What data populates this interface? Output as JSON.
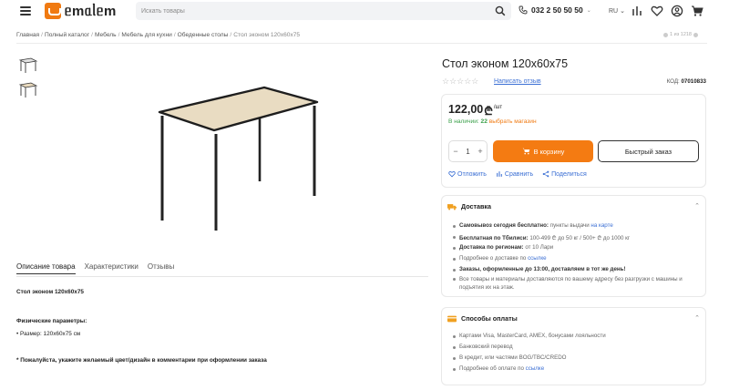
{
  "header": {
    "logo_text": "ᥱmᥲᥣᥱm",
    "search_placeholder": "Искать товары",
    "phone": "032 2 50 50 50",
    "phone_chevron": "⌄",
    "lang": "RU",
    "lang_chevron": "⌄",
    "brand_color": "#f07a12"
  },
  "breadcrumb": {
    "items": [
      "Главная",
      "Полный каталог",
      "Мебель",
      "Мебель для кухни",
      "Обеденные столы"
    ],
    "current": "Стол эконом 120х60х75",
    "separator": "/"
  },
  "counter": "1 из 1218",
  "tabs": [
    "Описание товара",
    "Характеристики",
    "Отзывы"
  ],
  "description": {
    "heading": "Стол эконом 120х60х75",
    "params_title": "Физические параметры:",
    "size": "• Размер: 120х60х75 см",
    "note": "* Пожалуйста, укажите желаемый цвет/дизайн в комментарии при оформлении заказа"
  },
  "product": {
    "title": "Стол эконом 120х60х75",
    "stars": "☆☆☆☆☆",
    "review_link": "Написать отзыв",
    "code_label": "КОД:",
    "code_value": "07010833",
    "price": "122,00",
    "currency": "₾",
    "price_unit": "/шт",
    "stock_label": "В наличии:",
    "stock_count": "22",
    "stock_link": "выбрать магазин",
    "qty_minus": "−",
    "qty_value": "1",
    "qty_plus": "+",
    "cart_label": "В корзину",
    "quick_label": "Быстрый заказ",
    "compare_links": [
      "Отложить",
      "Сравнить",
      "Поделиться"
    ]
  },
  "delivery": {
    "title": "Доставка",
    "chevron": "⌃",
    "pickup_bold": "Самовывоз сегодня бесплатно:",
    "pickup_rest": "пункты выдачи",
    "pickup_link": "на карте",
    "free_bold": "Бесплатная по Тбилиси:",
    "free_rest": "100-499 ₾ до 50 кг / 500+ ₾ до 1000 кг",
    "regions_bold": "Доставка по регионам:",
    "regions_rest": "от 10 Лари",
    "more_text": "Подробнее о доставке по",
    "more_link": "ссылке",
    "orders_bold": "Заказы, оформленные до 13:00, доставляем в тот же день!",
    "all_goods": "Все товары и материалы доставляются по вашему адресу без разгрузки с машины и подъятия их на этаж."
  },
  "payment": {
    "title": "Способы оплаты",
    "chevron": "⌃",
    "items": [
      "Картами Visa, MasterCard, AMEX, бонусами лояльности",
      "Банковский перевод",
      "В кредит, или частями BOG/TBC/CREDO"
    ],
    "more_text": "Подробнее об оплате по",
    "more_link": "ссылке"
  }
}
